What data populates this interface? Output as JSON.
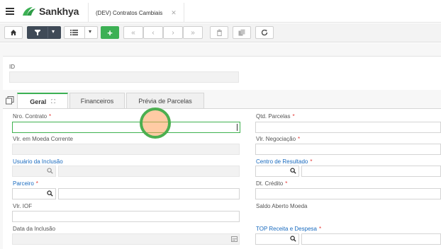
{
  "header": {
    "brand": "Sankhya",
    "tab_title": "(DEV) Contratos Cambiais",
    "tab_close": "✕"
  },
  "toolbar": {
    "buttons": [
      "home",
      "filter",
      "list",
      "add",
      "first",
      "prev",
      "next",
      "last",
      "delete",
      "copy",
      "refresh"
    ]
  },
  "form": {
    "id_label": "ID",
    "tabs": [
      "Geral",
      "Financeiros",
      "Prévia de Parcelas"
    ],
    "left": {
      "nro_contrato": "Nro. Contrato",
      "vlr_moeda": "Vlr. em Moeda Corrente",
      "usuario": "Usuário da Inclusão",
      "parceiro": "Parceiro",
      "vlr_iof": "Vlr. IOF",
      "data_inclusao": "Data da Inclusão"
    },
    "right": {
      "qtd_parcelas": "Qtd. Parcelas",
      "vlr_negociacao": "Vlr. Negociação",
      "centro_resultado": "Centro de Resultado",
      "dt_credito": "Dt. Crédito",
      "saldo_aberto": "Saldo Aberto Moeda",
      "top_receita": "TOP Receita e Despesa"
    },
    "required_mark": "*"
  }
}
